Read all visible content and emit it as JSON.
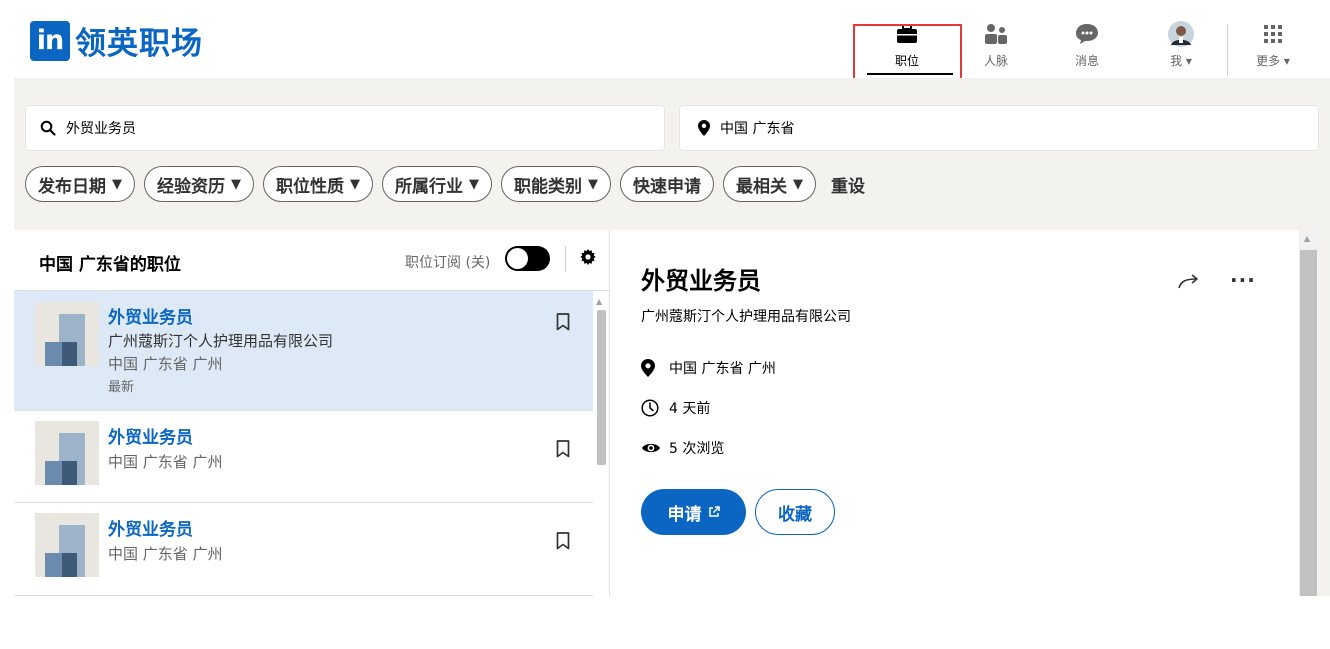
{
  "brand": {
    "logo_mark": "in",
    "name": "领英职场",
    "color": "#0a66c2"
  },
  "nav": [
    {
      "label": "职位",
      "icon": "briefcase-icon",
      "active": true
    },
    {
      "label": "人脉",
      "icon": "people-icon"
    },
    {
      "label": "消息",
      "icon": "message-icon"
    },
    {
      "label": "我 ▾",
      "icon": "avatar"
    },
    {
      "label": "更多 ▾",
      "icon": "grid-icon"
    }
  ],
  "search": {
    "keyword": "外贸业务员",
    "location": "中国 广东省"
  },
  "filters": [
    "发布日期",
    "经验资历",
    "职位性质",
    "所属行业",
    "职能类别",
    "快速申请",
    "最相关"
  ],
  "reset_label": "重设",
  "list": {
    "title": "中国 广东省的职位",
    "subscribe_label": "职位订阅 (关)",
    "jobs": [
      {
        "title": "外贸业务员",
        "company": "广州蔻斯汀个人护理用品有限公司",
        "location": "中国 广东省 广州",
        "badge": "最新"
      },
      {
        "title": "外贸业务员",
        "location": "中国 广东省 广州"
      },
      {
        "title": "外贸业务员",
        "location": "中国 广东省 广州"
      }
    ]
  },
  "detail": {
    "title": "外贸业务员",
    "company": "广州蔻斯汀个人护理用品有限公司",
    "location": "中国 广东省 广州",
    "posted": "4 天前",
    "views": "5 次浏览",
    "apply_label": "申请",
    "save_label": "收藏"
  }
}
